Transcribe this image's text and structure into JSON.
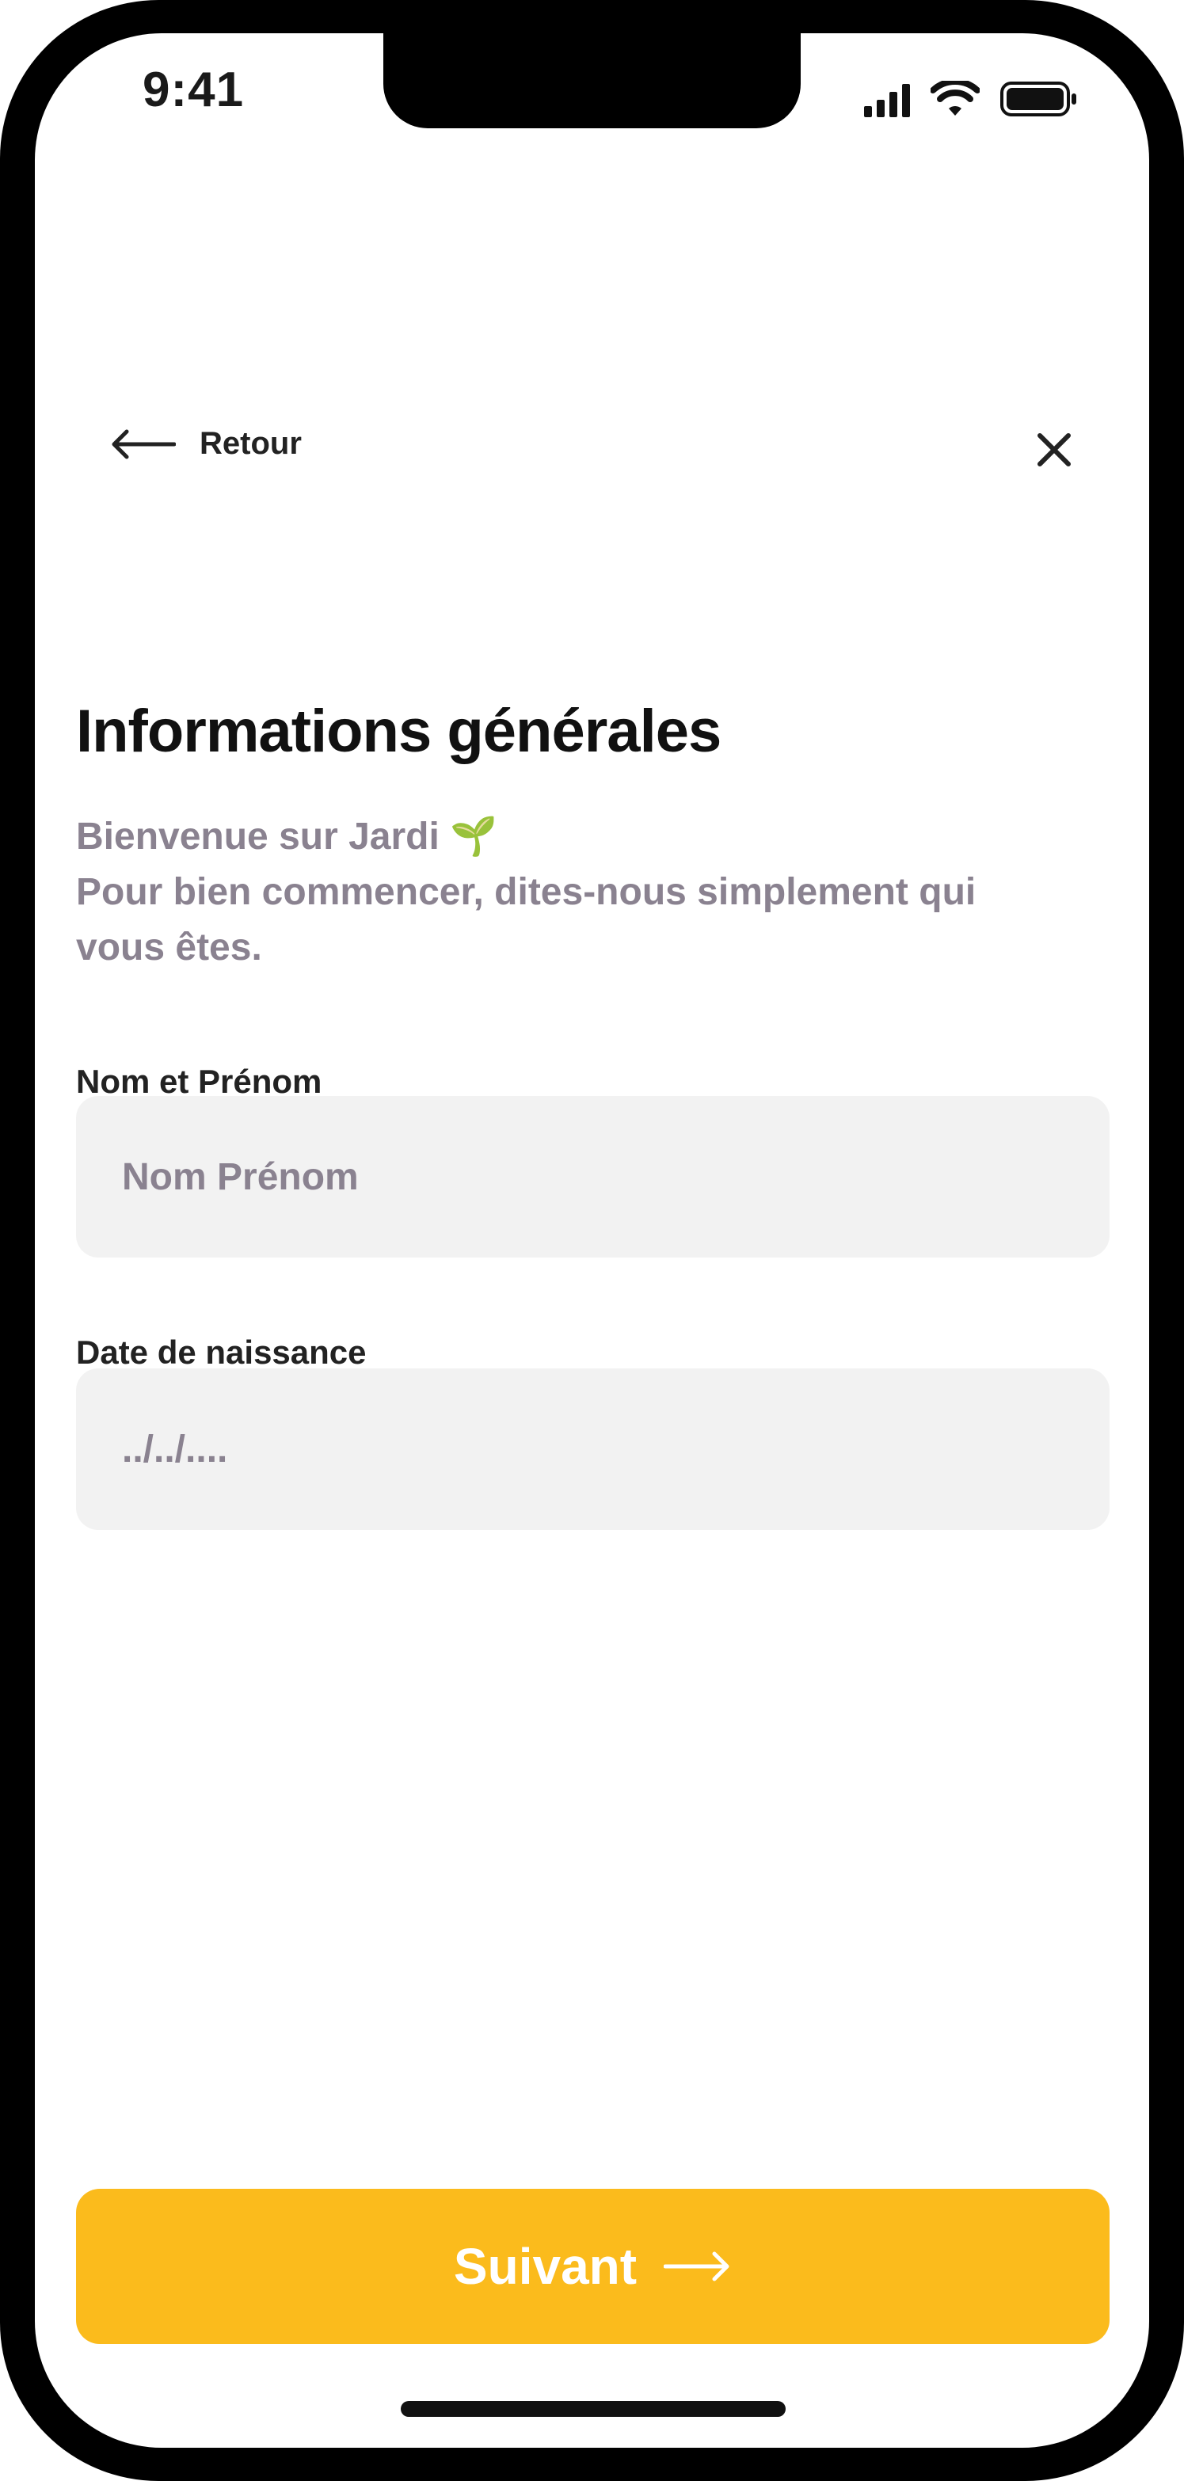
{
  "status_bar": {
    "time": "9:41"
  },
  "nav": {
    "back_label": "Retour",
    "back_icon": "arrow-left-icon",
    "close_icon": "close-icon"
  },
  "header": {
    "title": "Informations générales",
    "subtitle_line1": "Bienvenue sur Jardi",
    "subtitle_emoji": "🌱",
    "subtitle_line2": "Pour bien commencer, dites-nous simplement qui",
    "subtitle_line3": "vous êtes."
  },
  "form": {
    "name_label": "Nom et Prénom",
    "name_placeholder": "Nom Prénom",
    "name_value": "",
    "birthdate_label": "Date de naissance",
    "birthdate_placeholder": "../../....",
    "birthdate_value": ""
  },
  "cta": {
    "label": "Suivant",
    "icon": "arrow-right-icon"
  },
  "colors": {
    "accent": "#fbbb1c",
    "input_bg": "#f2f2f2",
    "muted_text": "#8a8290",
    "title_text": "#111111"
  }
}
